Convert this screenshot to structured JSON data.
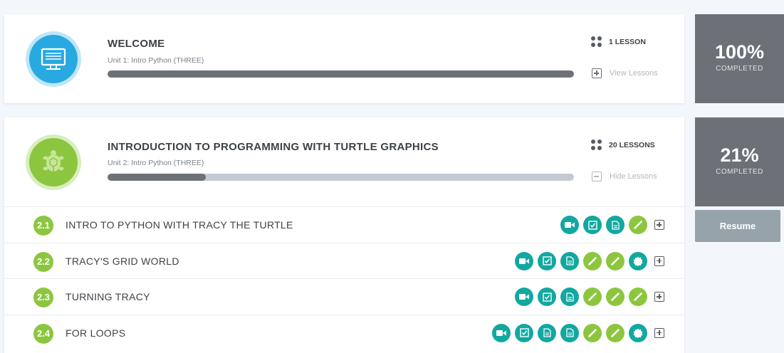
{
  "units": [
    {
      "title": "WELCOME",
      "subtitle": "Unit 1: Intro Python (THREE)",
      "progress": 1.0,
      "lesson_count": "1 LESSON",
      "toggle_label": "View Lessons",
      "percent": "100%",
      "percent_label": "COMPLETED",
      "badge_icon": "computer-icon"
    },
    {
      "title": "INTRODUCTION TO PROGRAMMING WITH TURTLE GRAPHICS",
      "subtitle": "Unit 2: Intro Python (THREE)",
      "progress": 0.21,
      "lesson_count": "20 LESSONS",
      "toggle_label": "Hide Lessons",
      "percent": "21%",
      "percent_label": "COMPLETED",
      "badge_icon": "turtle-icon",
      "resume_label": "Resume"
    }
  ],
  "lessons": [
    {
      "number": "2.1",
      "title": "INTRO TO PYTHON WITH TRACY THE TURTLE",
      "activities": [
        "video",
        "quiz",
        "document",
        "exercise"
      ]
    },
    {
      "number": "2.2",
      "title": "TRACY'S GRID WORLD",
      "activities": [
        "video",
        "quiz",
        "document",
        "exercise",
        "exercise",
        "badge"
      ]
    },
    {
      "number": "2.3",
      "title": "TURNING TRACY",
      "activities": [
        "video",
        "quiz",
        "document",
        "exercise",
        "exercise",
        "exercise"
      ]
    },
    {
      "number": "2.4",
      "title": "FOR LOOPS",
      "activities": [
        "video",
        "quiz",
        "document",
        "document",
        "exercise",
        "exercise",
        "badge"
      ]
    }
  ],
  "colors": {
    "teal": "#11a8a0",
    "green": "#8cc63f",
    "blue": "#29a9e1",
    "gray": "#6b7177",
    "resume": "#96a3ab"
  }
}
